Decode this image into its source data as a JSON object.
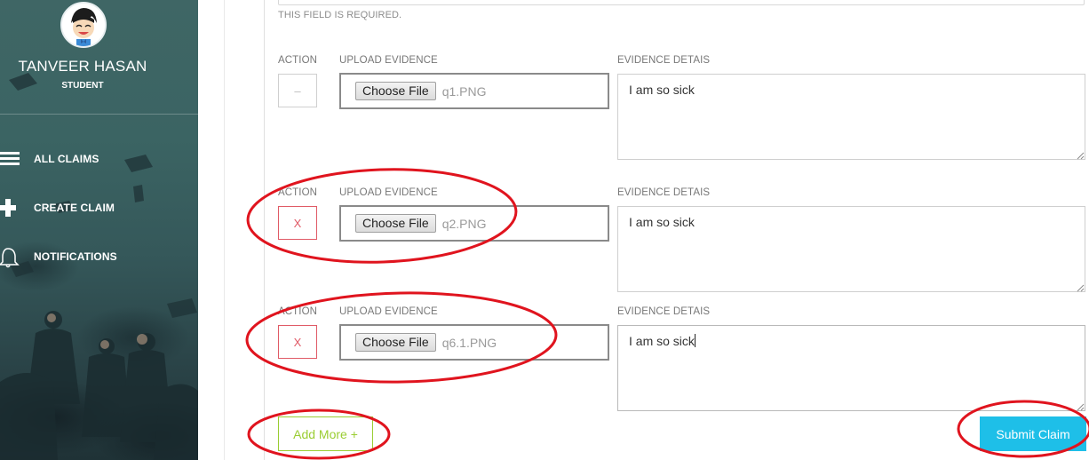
{
  "sidebar": {
    "user_name": "TANVEER HASAN",
    "user_role": "STUDENT",
    "items": [
      {
        "label": "ALL CLAIMS",
        "icon": "list-icon"
      },
      {
        "label": "CREATE CLAIM",
        "icon": "plus-icon"
      },
      {
        "label": "NOTIFICATIONS",
        "icon": "bell-icon"
      }
    ]
  },
  "form": {
    "required_message": "THIS FIELD IS REQUIRED.",
    "rows": [
      {
        "action_label": "ACTION",
        "upload_label": "UPLOAD EVIDENCE",
        "details_label": "EVIDENCE DETAIS",
        "action_symbol": "–",
        "choose_file_label": "Choose File",
        "file_name": "q1.PNG",
        "details_value": "I am so sick"
      },
      {
        "action_label": "ACTION",
        "upload_label": "UPLOAD EVIDENCE",
        "details_label": "EVIDENCE DETAIS",
        "action_symbol": "X",
        "choose_file_label": "Choose File",
        "file_name": "q2.PNG",
        "details_value": "I am so sick"
      },
      {
        "action_label": "ACTION",
        "upload_label": "UPLOAD EVIDENCE",
        "details_label": "EVIDENCE DETAIS",
        "action_symbol": "X",
        "choose_file_label": "Choose File",
        "file_name": "q6.1.PNG",
        "details_value": "I am so sick"
      }
    ],
    "add_more_label": "Add More +",
    "submit_label": "Submit Claim"
  },
  "colors": {
    "remove_red": "#e05a66",
    "add_green": "#9acd32",
    "submit_blue": "#1ebfe8",
    "annotation_red": "#e0141e"
  }
}
